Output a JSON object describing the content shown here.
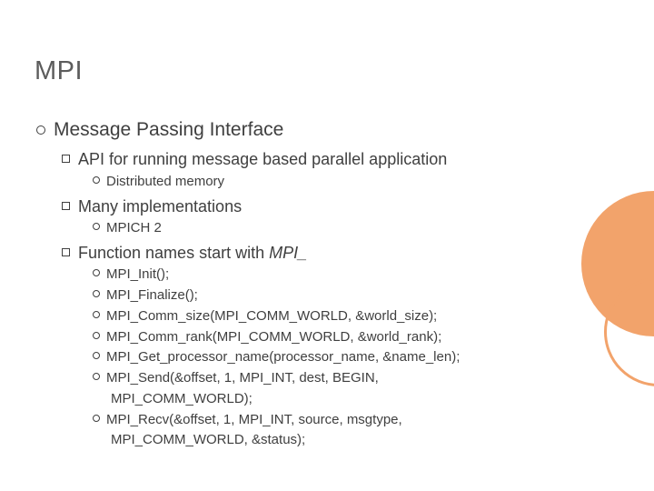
{
  "title": "MPI",
  "lvl1": "Message Passing Interface",
  "sub": {
    "api": "API for running message based parallel application",
    "api_item": "Distributed memory",
    "impl": "Many implementations",
    "impl_item": "MPICH 2",
    "func": "Function names start with ",
    "func_em": "MPI_",
    "funcs": [
      "MPI_Init();",
      "MPI_Finalize();",
      "MPI_Comm_size(MPI_COMM_WORLD, &world_size);",
      "MPI_Comm_rank(MPI_COMM_WORLD, &world_rank);",
      "MPI_Get_processor_name(processor_name, &name_len);"
    ],
    "func_send_a": "MPI_Send(&offset, 1, MPI_INT, dest, BEGIN,",
    "func_send_b": "MPI_COMM_WORLD);",
    "func_recv_a": "MPI_Recv(&offset, 1, MPI_INT, source, msgtype,",
    "func_recv_b": "MPI_COMM_WORLD, &status);"
  }
}
